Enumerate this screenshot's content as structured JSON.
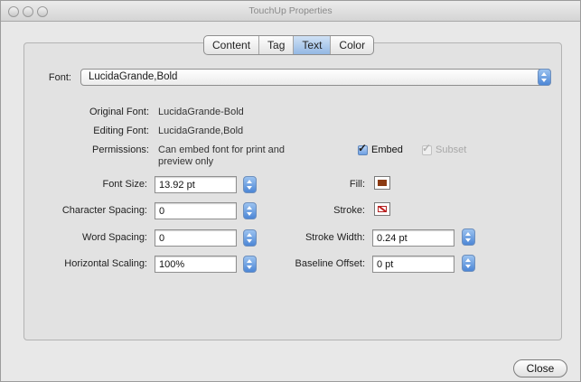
{
  "window": {
    "title": "TouchUp Properties"
  },
  "tabs": [
    {
      "label": "Content",
      "active": false
    },
    {
      "label": "Tag",
      "active": false
    },
    {
      "label": "Text",
      "active": true
    },
    {
      "label": "Color",
      "active": false
    }
  ],
  "font": {
    "label": "Font:",
    "selected": "LucidaGrande,Bold"
  },
  "info": {
    "original_font_label": "Original Font:",
    "original_font_value": "LucidaGrande-Bold",
    "editing_font_label": "Editing Font:",
    "editing_font_value": "LucidaGrande,Bold",
    "permissions_label": "Permissions:",
    "permissions_value_line1": "Can embed font for print and",
    "permissions_value_line2": "preview only",
    "embed_label": "Embed",
    "embed_checked": true,
    "subset_label": "Subset",
    "subset_checked": true,
    "subset_enabled": false
  },
  "fields": {
    "font_size_label": "Font Size:",
    "font_size_value": "13.92 pt",
    "character_spacing_label": "Character Spacing:",
    "character_spacing_value": "0",
    "word_spacing_label": "Word Spacing:",
    "word_spacing_value": "0",
    "horizontal_scaling_label": "Horizontal Scaling:",
    "horizontal_scaling_value": "100%",
    "fill_label": "Fill:",
    "fill_color": "#8b3a12",
    "stroke_label": "Stroke:",
    "stroke_color": "#c21d1d",
    "stroke_width_label": "Stroke Width:",
    "stroke_width_value": "0.24 pt",
    "baseline_offset_label": "Baseline Offset:",
    "baseline_offset_value": "0 pt"
  },
  "footer": {
    "close_label": "Close"
  }
}
